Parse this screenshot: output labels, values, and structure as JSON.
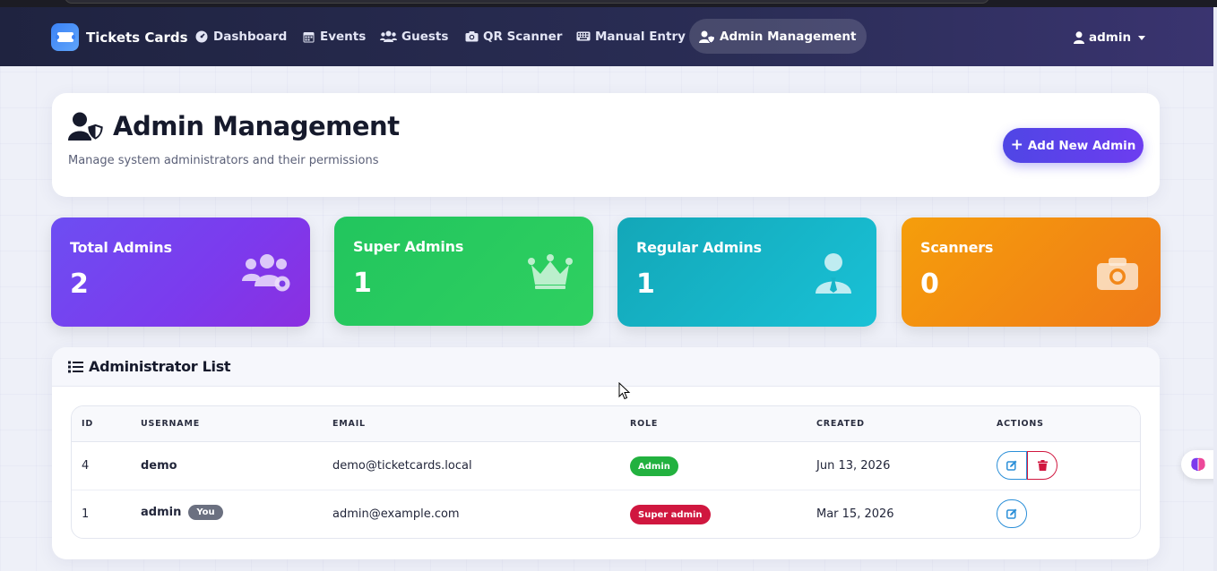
{
  "nav": {
    "brand": "Tickets Cards",
    "items": [
      {
        "label": "Dashboard",
        "icon": "dashboard-icon"
      },
      {
        "label": "Events",
        "icon": "calendar-icon"
      },
      {
        "label": "Guests",
        "icon": "users-icon"
      },
      {
        "label": "QR Scanner",
        "icon": "camera-icon"
      },
      {
        "label": "Manual Entry",
        "icon": "keyboard-icon"
      },
      {
        "label": "Admin Management",
        "icon": "user-shield-icon",
        "active": true
      }
    ],
    "user": "admin"
  },
  "header": {
    "title": "Admin Management",
    "subtitle": "Manage system administrators and their permissions",
    "add_button": "Add New Admin"
  },
  "stats": [
    {
      "label": "Total Admins",
      "value": "2",
      "icon": "users-cog-icon",
      "color": "#7c3aed"
    },
    {
      "label": "Super Admins",
      "value": "1",
      "icon": "crown-icon",
      "color": "#22c55e"
    },
    {
      "label": "Regular Admins",
      "value": "1",
      "icon": "user-tie-icon",
      "color": "#13a7b8"
    },
    {
      "label": "Scanners",
      "value": "0",
      "icon": "camera-icon",
      "color": "#f59e0b"
    }
  ],
  "list": {
    "title": "Administrator List",
    "columns": [
      "ID",
      "USERNAME",
      "EMAIL",
      "ROLE",
      "CREATED",
      "ACTIONS"
    ],
    "rows": [
      {
        "id": "4",
        "username": "demo",
        "email": "demo@ticketcards.local",
        "role": "Admin",
        "created": "Jun 13, 2026"
      },
      {
        "id": "1",
        "username": "admin",
        "you_badge": "You",
        "email": "admin@example.com",
        "role": "Super admin",
        "created": "Mar 15, 2026"
      }
    ]
  }
}
